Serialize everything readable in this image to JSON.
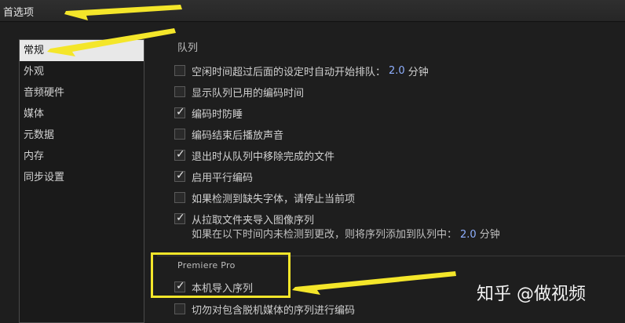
{
  "window": {
    "title": "首选项"
  },
  "sidebar": {
    "items": [
      {
        "label": "常规",
        "active": true
      },
      {
        "label": "外观"
      },
      {
        "label": "音频硬件"
      },
      {
        "label": "媒体"
      },
      {
        "label": "元数据"
      },
      {
        "label": "内存"
      },
      {
        "label": "同步设置"
      }
    ]
  },
  "queue_section": {
    "title": "队列",
    "options": [
      {
        "label_pre": "空闲时间超过后面的设定时自动开始排队：",
        "value": "2.0",
        "label_post": "分钟",
        "checked": false
      },
      {
        "label": "显示队列已用的编码时间",
        "checked": false
      },
      {
        "label": "编码时防睡",
        "checked": true
      },
      {
        "label": "编码结束后播放声音",
        "checked": false
      },
      {
        "label": "退出时从队列中移除完成的文件",
        "checked": true
      },
      {
        "label": "启用平行编码",
        "checked": true
      },
      {
        "label": "如果检测到缺失字体，请停止当前项",
        "checked": false
      },
      {
        "label": "从拉取文件夹导入图像序列",
        "checked": true
      }
    ],
    "sub_note": {
      "label_pre": "如果在以下时间内未检测到更改，则将序列添加到队列中：",
      "value": "2.0",
      "label_post": "分钟"
    }
  },
  "premiere_section": {
    "title": "Premiere Pro",
    "options": [
      {
        "label": "本机导入序列",
        "checked": true
      },
      {
        "label": "切勿对包含脱机媒体的序列进行编码",
        "checked": false
      }
    ]
  },
  "watermark": {
    "text": "知乎 @做视频"
  },
  "colors": {
    "highlight": "#f4e62a",
    "accent_value": "#8fb0ff",
    "background": "#1e1e1e"
  }
}
